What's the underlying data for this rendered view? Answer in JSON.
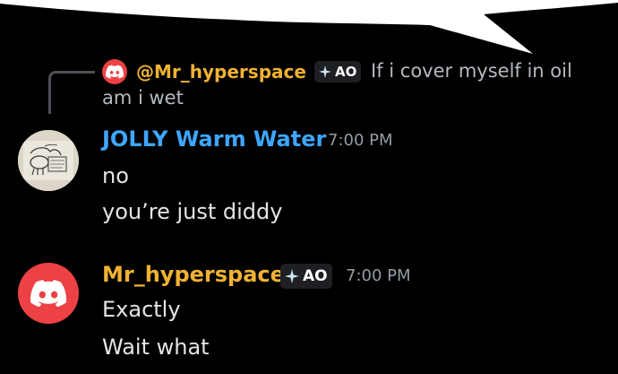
{
  "colors": {
    "background": "#000000",
    "bubble": "#ffffff",
    "jolly_name": "#3ea6ff",
    "hyperspace_name": "#f0b232",
    "discord_red": "#ed4245",
    "tag_bg": "#1e1f22",
    "muted": "#949ba4"
  },
  "reply": {
    "author": "@Mr_hyperspace",
    "tag_label": "AO",
    "tag_icon": "sparkle-icon",
    "avatar_icon": "discord-logo-icon",
    "text": "If i cover myself in oil am i wet"
  },
  "messages": [
    {
      "author": "JOLLY Warm Water",
      "timestamp": "7:00 PM",
      "avatar": "hand-drawn-sketch-avatar",
      "lines": [
        "no",
        "you’re just diddy"
      ]
    },
    {
      "author": "Mr_hyperspace",
      "tag_label": "AO",
      "tag_icon": "sparkle-icon",
      "timestamp": "7:00 PM",
      "avatar": "discord-logo-icon",
      "lines": [
        "Exactly",
        "Wait what"
      ]
    }
  ]
}
